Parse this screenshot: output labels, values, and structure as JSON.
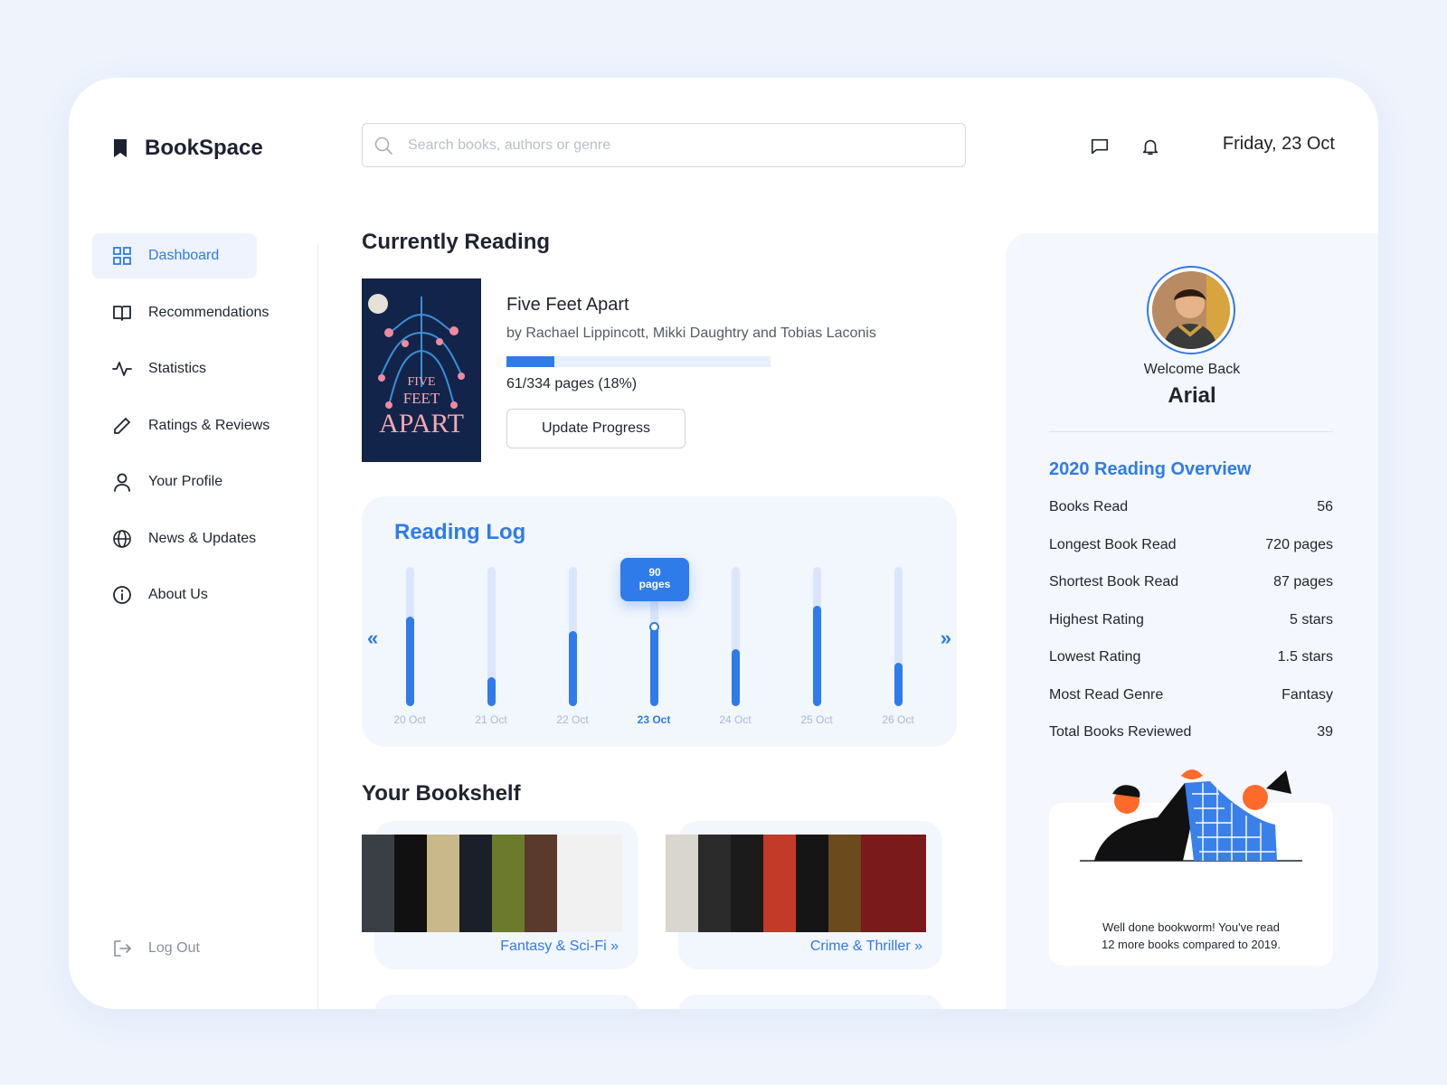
{
  "app": {
    "name": "BookSpace"
  },
  "header": {
    "search_placeholder": "Search books, authors or genre",
    "date": "Friday, 23 Oct"
  },
  "sidebar": {
    "items": [
      {
        "label": "Dashboard",
        "icon": "grid-icon",
        "active": true
      },
      {
        "label": "Recommendations",
        "icon": "book-open-icon"
      },
      {
        "label": "Statistics",
        "icon": "activity-icon"
      },
      {
        "label": "Ratings & Reviews",
        "icon": "pencil-icon"
      },
      {
        "label": "Your Profile",
        "icon": "user-icon"
      },
      {
        "label": "News & Updates",
        "icon": "globe-icon"
      },
      {
        "label": "About Us",
        "icon": "info-icon"
      }
    ],
    "logout": "Log Out"
  },
  "current": {
    "section_title": "Currently Reading",
    "title": "Five Feet Apart",
    "author": "by Rachael Lippincott, Mikki Daughtry and Tobias Laconis",
    "pages_read": 61,
    "pages_total": 334,
    "progress_fraction": 0.18,
    "pages_text": "61/334 pages (18%)",
    "button": "Update Progress",
    "cover_text": {
      "line1": "FIVE",
      "line2": "FEET",
      "line3": "APART"
    }
  },
  "reading_log": {
    "title": "Reading Log",
    "tooltip_value": "90",
    "tooltip_unit": "pages",
    "days": [
      {
        "label": "20 Oct",
        "fill": 0.64
      },
      {
        "label": "21 Oct",
        "fill": 0.21
      },
      {
        "label": "22 Oct",
        "fill": 0.54
      },
      {
        "label": "23 Oct",
        "fill": 0.58,
        "active": true
      },
      {
        "label": "24 Oct",
        "fill": 0.41
      },
      {
        "label": "25 Oct",
        "fill": 0.72
      },
      {
        "label": "26 Oct",
        "fill": 0.31
      }
    ]
  },
  "bookshelf": {
    "title": "Your Bookshelf",
    "shelves": [
      {
        "label": "Fantasy & Sci-Fi"
      },
      {
        "label": "Crime & Thriller"
      }
    ]
  },
  "profile": {
    "welcome": "Welcome Back",
    "name": "Arial"
  },
  "overview": {
    "title": "2020 Reading Overview",
    "rows": [
      {
        "label": "Books Read",
        "value": "56"
      },
      {
        "label": "Longest Book Read",
        "value": "720 pages"
      },
      {
        "label": "Shortest Book Read",
        "value": "87 pages"
      },
      {
        "label": "Highest Rating",
        "value": "5 stars"
      },
      {
        "label": "Lowest Rating",
        "value": "1.5 stars"
      },
      {
        "label": "Most Read Genre",
        "value": "Fantasy"
      },
      {
        "label": "Total Books Reviewed",
        "value": "39"
      }
    ]
  },
  "achievement": {
    "line1": "Well done bookworm! You've read",
    "line2": "12 more books compared to 2019."
  },
  "colors": {
    "accent": "#2f7bea",
    "panel": "#f2f6fd"
  }
}
